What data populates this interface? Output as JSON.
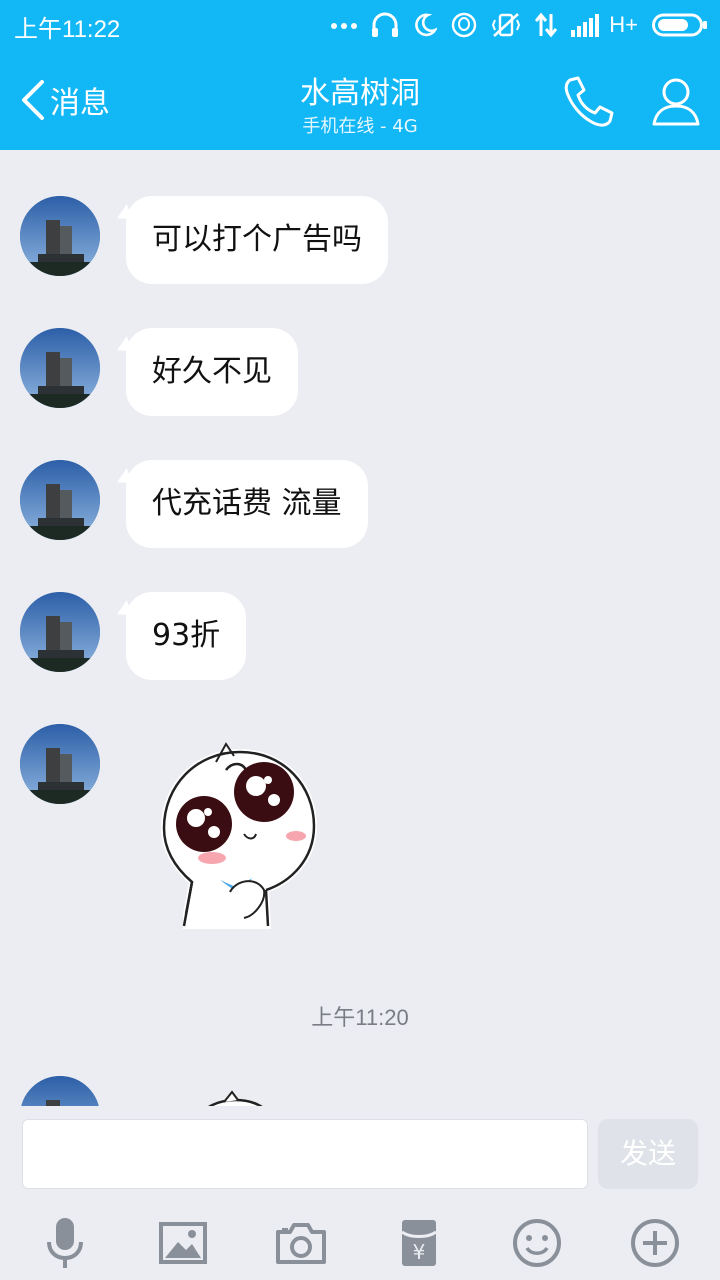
{
  "status_bar": {
    "time": "上午11:22",
    "network": "H+",
    "icons": [
      "more-dots-icon",
      "headphones-icon",
      "moon-icon",
      "qq-icon",
      "vibrate-off-icon",
      "data-arrows-icon",
      "signal-icon",
      "battery-icon"
    ]
  },
  "header": {
    "back_label": "消息",
    "title": "水高树洞",
    "subtitle": "手机在线 - 4G"
  },
  "messages": [
    {
      "type": "text",
      "text": "可以打个广告吗"
    },
    {
      "type": "text",
      "text": "好久不见"
    },
    {
      "type": "text",
      "text": "代充话费 流量"
    },
    {
      "type": "text",
      "text": "93折"
    },
    {
      "type": "sticker",
      "sticker": "cute-cat-sticker"
    },
    {
      "type": "sticker",
      "sticker": "cute-cat-sticker"
    }
  ],
  "timestamp": "上午11:20",
  "input": {
    "placeholder": "",
    "send_label": "发送"
  },
  "toolbar": [
    "microphone-icon",
    "image-icon",
    "camera-icon",
    "red-packet-icon",
    "emoji-icon",
    "plus-icon"
  ],
  "colors": {
    "brand": "#12b7f5",
    "background": "#ebedf3",
    "bubble": "#ffffff"
  }
}
